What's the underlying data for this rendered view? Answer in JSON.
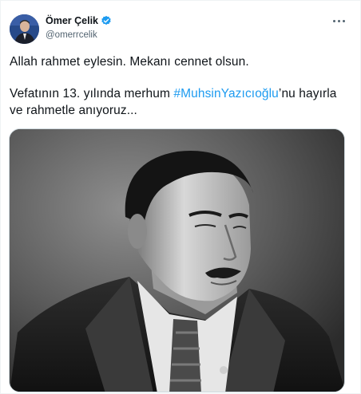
{
  "author": {
    "display_name": "Ömer Çelik",
    "handle": "@omerrcelik",
    "verified": true,
    "verified_color": "#1d9bf0"
  },
  "tweet": {
    "line1": "Allah rahmet eylesin. Mekanı cennet olsun.",
    "line2_prefix": "Vefatının 13. yılında merhum ",
    "hashtag": "#MuhsinYazıcıoğlu",
    "line2_suffix": "’nu hayırla ve rahmetle anıyoruz...",
    "hashtag_color": "#1d9bf0"
  },
  "media": {
    "kind": "black-and-white portrait photo"
  },
  "icons": {
    "more": "more-options-icon",
    "verified": "verified-badge-icon"
  }
}
